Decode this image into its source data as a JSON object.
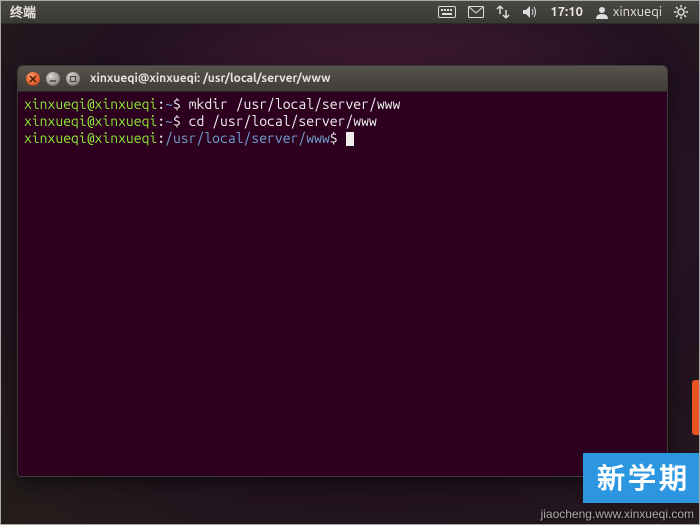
{
  "panel": {
    "app_name": "终端",
    "clock": "17:10",
    "username": "xinxueqi"
  },
  "window": {
    "title": "xinxueqi@xinxueqi: /usr/local/server/www"
  },
  "terminal": {
    "lines": [
      {
        "prompt_user": "xinxueqi@xinxueqi",
        "prompt_path": "~",
        "command": "mkdir /usr/local/server/www"
      },
      {
        "prompt_user": "xinxueqi@xinxueqi",
        "prompt_path": "~",
        "command": "cd /usr/local/server/www"
      },
      {
        "prompt_user": "xinxueqi@xinxueqi",
        "prompt_path": "/usr/local/server/www",
        "command": ""
      }
    ]
  },
  "watermark": {
    "banner": "新学期",
    "sub": "jiaocheng.www.xinxueqi.com"
  }
}
